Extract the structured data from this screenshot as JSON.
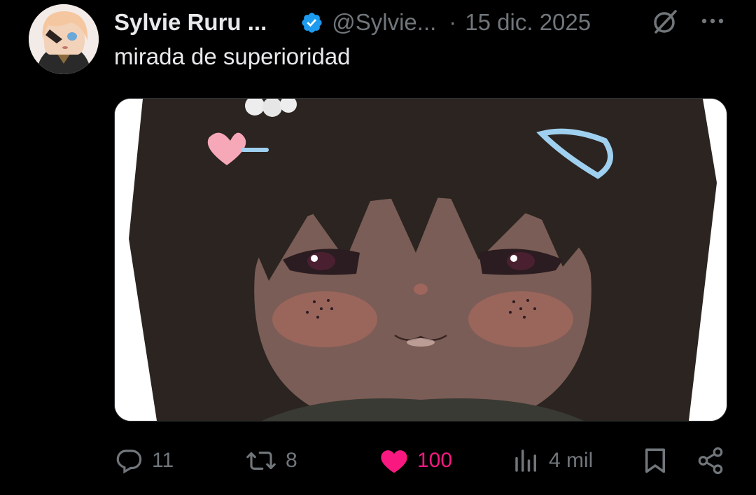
{
  "tweet": {
    "display_name": "Sylvie Ruru ...",
    "handle": "@Sylvie...",
    "separator": "·",
    "date": "15 dic. 2025",
    "text": "mirada de superioridad"
  },
  "actions": {
    "replies": "11",
    "reposts": "8",
    "likes": "100",
    "views": "4 mil"
  },
  "colors": {
    "background": "#000000",
    "primary_text": "#e7e9ea",
    "secondary_text": "#71767b",
    "verified_blue": "#1d9bf0",
    "like_pink": "#f91880"
  },
  "icons": {
    "verified": "verified-badge-icon",
    "grok": "grok-icon",
    "more": "more-icon",
    "reply": "reply-icon",
    "repost": "repost-icon",
    "like": "heart-icon",
    "views": "views-icon",
    "bookmark": "bookmark-icon",
    "share": "share-icon"
  }
}
